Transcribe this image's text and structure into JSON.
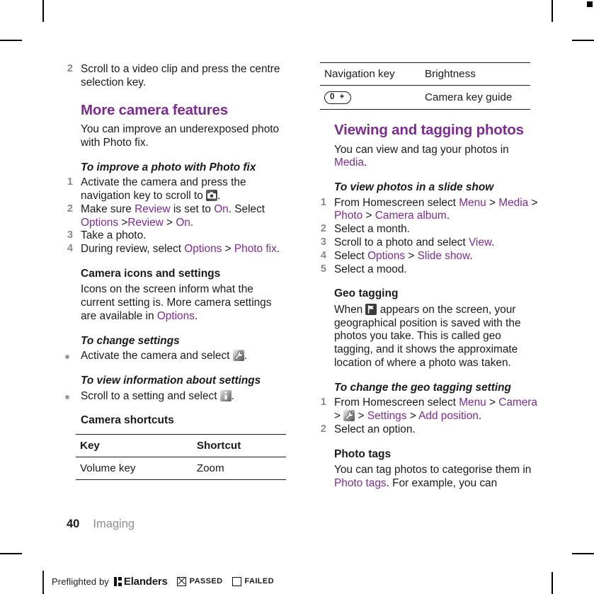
{
  "document": {
    "page_number": "40",
    "chapter": "Imaging"
  },
  "left_column": {
    "step_continued": {
      "num": "2",
      "text": "Scroll to a video clip and press the centre selection key."
    },
    "heading_more_camera_features": "More camera features",
    "intro_paragraph": "You can improve an underexposed photo with Photo fix.",
    "proc_photo_fix": {
      "title": "To improve a photo with Photo fix",
      "steps": [
        {
          "num": "1",
          "parts": [
            {
              "t": "Activate the camera and press the navigation key to scroll to ",
              "style": "plain"
            },
            {
              "t": "camera-icon",
              "style": "icon"
            },
            {
              "t": ".",
              "style": "plain"
            }
          ]
        },
        {
          "num": "2",
          "parts": [
            {
              "t": "Make sure ",
              "style": "plain"
            },
            {
              "t": "Review",
              "style": "link"
            },
            {
              "t": " is set to ",
              "style": "plain"
            },
            {
              "t": "On",
              "style": "link"
            },
            {
              "t": ". Select ",
              "style": "plain"
            },
            {
              "t": "Options",
              "style": "link"
            },
            {
              "t": " >",
              "style": "plain"
            },
            {
              "t": "Review",
              "style": "link"
            },
            {
              "t": " > ",
              "style": "plain"
            },
            {
              "t": "On",
              "style": "link"
            },
            {
              "t": ".",
              "style": "plain"
            }
          ]
        },
        {
          "num": "3",
          "parts": [
            {
              "t": "Take a photo.",
              "style": "plain"
            }
          ]
        },
        {
          "num": "4",
          "parts": [
            {
              "t": "During review, select ",
              "style": "plain"
            },
            {
              "t": "Options",
              "style": "link"
            },
            {
              "t": " > ",
              "style": "plain"
            },
            {
              "t": "Photo fix",
              "style": "link"
            },
            {
              "t": ".",
              "style": "plain"
            }
          ]
        }
      ]
    },
    "heading_camera_icons": "Camera icons and settings",
    "camera_icons_paragraph": {
      "before": "Icons on the screen inform what the current setting is. More camera settings are available in ",
      "link": "Options",
      "after": "."
    },
    "proc_change_settings": {
      "title": "To change settings",
      "bullet_before": "Activate the camera and select ",
      "bullet_icon": "wrench-icon",
      "bullet_after": "."
    },
    "proc_view_info": {
      "title": "To view information about settings",
      "bullet_before": "Scroll to a setting and select ",
      "bullet_icon": "info-icon",
      "bullet_after": "."
    },
    "heading_camera_shortcuts": "Camera shortcuts",
    "shortcuts_table": {
      "headers": [
        "Key",
        "Shortcut"
      ],
      "rows": [
        [
          "Volume key",
          "Zoom"
        ]
      ]
    }
  },
  "right_column": {
    "shortcuts_table_continued": {
      "rows": [
        {
          "key": "Navigation key",
          "key_is_icon": false,
          "shortcut": "Brightness"
        },
        {
          "key": "0 +",
          "key_is_icon": true,
          "shortcut": "Camera key guide"
        }
      ]
    },
    "heading_viewing_tagging": "Viewing and tagging photos",
    "intro_paragraph": {
      "before": "You can view and tag your photos in ",
      "link": "Media",
      "after": "."
    },
    "proc_slide_show": {
      "title": "To view photos in a slide show",
      "steps": [
        {
          "num": "1",
          "parts": [
            {
              "t": "From Homescreen select ",
              "style": "plain"
            },
            {
              "t": "Menu",
              "style": "link"
            },
            {
              "t": " > ",
              "style": "plain"
            },
            {
              "t": "Media",
              "style": "link"
            },
            {
              "t": " > ",
              "style": "plain"
            },
            {
              "t": "Photo",
              "style": "link"
            },
            {
              "t": " > ",
              "style": "plain"
            },
            {
              "t": "Camera album",
              "style": "link"
            },
            {
              "t": ".",
              "style": "plain"
            }
          ]
        },
        {
          "num": "2",
          "parts": [
            {
              "t": "Select a month.",
              "style": "plain"
            }
          ]
        },
        {
          "num": "3",
          "parts": [
            {
              "t": "Scroll to a photo and select ",
              "style": "plain"
            },
            {
              "t": "View",
              "style": "link"
            },
            {
              "t": ".",
              "style": "plain"
            }
          ]
        },
        {
          "num": "4",
          "parts": [
            {
              "t": "Select ",
              "style": "plain"
            },
            {
              "t": "Options",
              "style": "link"
            },
            {
              "t": " > ",
              "style": "plain"
            },
            {
              "t": "Slide show",
              "style": "link"
            },
            {
              "t": ".",
              "style": "plain"
            }
          ]
        },
        {
          "num": "5",
          "parts": [
            {
              "t": "Select a mood.",
              "style": "plain"
            }
          ]
        }
      ]
    },
    "heading_geo_tagging": "Geo tagging",
    "geo_tagging_paragraph": {
      "before": "When ",
      "icon": "flag-icon",
      "after": " appears on the screen, your geographical position is saved with the photos you take. This is called geo tagging, and it shows the approximate location of where a photo was taken."
    },
    "proc_geo_setting": {
      "title": "To change the geo tagging setting",
      "steps": [
        {
          "num": "1",
          "parts": [
            {
              "t": "From Homescreen select ",
              "style": "plain"
            },
            {
              "t": "Menu",
              "style": "link"
            },
            {
              "t": " > ",
              "style": "plain"
            },
            {
              "t": "Camera",
              "style": "link"
            },
            {
              "t": " > ",
              "style": "plain"
            },
            {
              "t": "wrench-icon",
              "style": "icon"
            },
            {
              "t": " > ",
              "style": "plain"
            },
            {
              "t": "Settings",
              "style": "link"
            },
            {
              "t": " > ",
              "style": "plain"
            },
            {
              "t": "Add position",
              "style": "link"
            },
            {
              "t": ".",
              "style": "plain"
            }
          ]
        },
        {
          "num": "2",
          "parts": [
            {
              "t": "Select an option.",
              "style": "plain"
            }
          ]
        }
      ]
    },
    "heading_photo_tags": "Photo tags",
    "photo_tags_paragraph": {
      "before": "You can tag photos to categorise them in ",
      "link": "Photo tags",
      "after": ". For example, you can"
    }
  },
  "preflight_bar": {
    "label": "Preflighted by",
    "brand": "Elanders",
    "passed_label": "PASSED",
    "failed_label": "FAILED",
    "passed_checked": true
  },
  "colors": {
    "accent_purple": "#7b2d8f",
    "body_text": "#1a1a1a",
    "muted_text": "#8d8d8d"
  }
}
